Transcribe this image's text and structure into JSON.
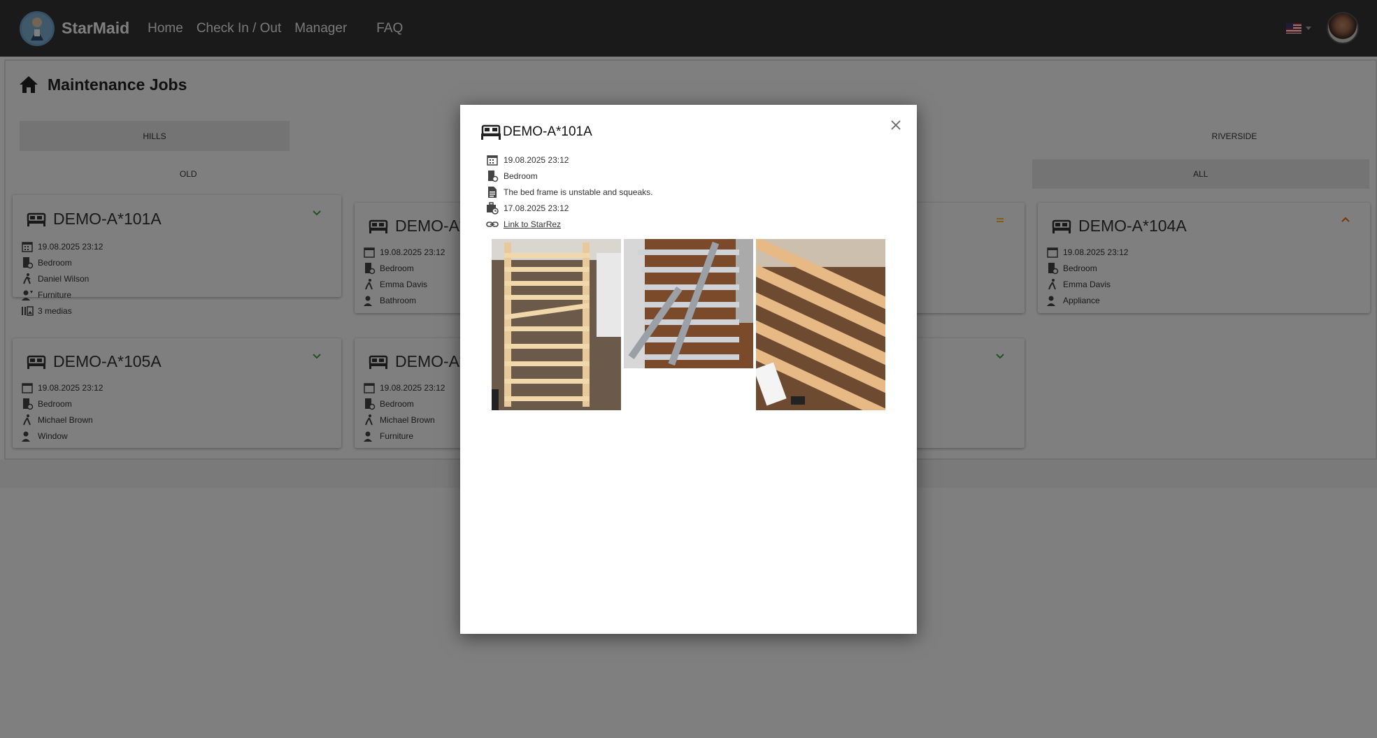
{
  "app": {
    "brand": "StarMaid"
  },
  "nav": {
    "home": "Home",
    "checkinout": "Check In / Out",
    "manager": "Manager",
    "faq": "FAQ"
  },
  "page": {
    "title": "Maintenance Jobs"
  },
  "tabs": [
    {
      "label": "HILLS",
      "active": true
    },
    {
      "label": "",
      "active": false
    },
    {
      "label": "",
      "active": false
    },
    {
      "label": "",
      "active": false
    },
    {
      "label": "RIVERSIDE",
      "active": false
    }
  ],
  "filters": [
    {
      "label": "OLD",
      "active": false
    },
    {
      "label": "",
      "active": false
    },
    {
      "label": "",
      "active": false
    },
    {
      "label": "ALL",
      "active": true
    }
  ],
  "cards": [
    {
      "title": "DEMO-A*101A",
      "date": "19.08.2025 23:12",
      "room": "Bedroom",
      "person": "Daniel Wilson",
      "category": "Furniture",
      "media": "3 medias",
      "priority": "low"
    },
    {
      "title": "DEMO-A*",
      "date": "19.08.2025 23:12",
      "room": "Bedroom",
      "person": "Emma Davis",
      "category": "Bathroom",
      "priority": "none"
    },
    {
      "title": "",
      "priority": "medium"
    },
    {
      "title": "DEMO-A*104A",
      "date": "19.08.2025 23:12",
      "room": "Bedroom",
      "person": "Emma Davis",
      "category": "Appliance",
      "priority": "high"
    },
    {
      "title": "DEMO-A*105A",
      "date": "19.08.2025 23:12",
      "room": "Bedroom",
      "person": "Michael Brown",
      "category": "Window",
      "priority": "low"
    },
    {
      "title": "DEMO-A*",
      "date": "19.08.2025 23:12",
      "room": "Bedroom",
      "person": "Michael Brown",
      "category": "Furniture",
      "priority": "none"
    },
    {
      "title": "",
      "priority": "low"
    }
  ],
  "modal": {
    "title": "DEMO-A*101A",
    "created": "19.08.2025 23:12",
    "room": "Bedroom",
    "description": "The bed frame is unstable and squeaks.",
    "due": "17.08.2025 23:12",
    "link_label": "Link to StarRez"
  },
  "colors": {
    "priority_low": "#43a047",
    "priority_medium": "#fbc02d",
    "priority_high": "#ef6c00",
    "navbar": "#343434"
  }
}
